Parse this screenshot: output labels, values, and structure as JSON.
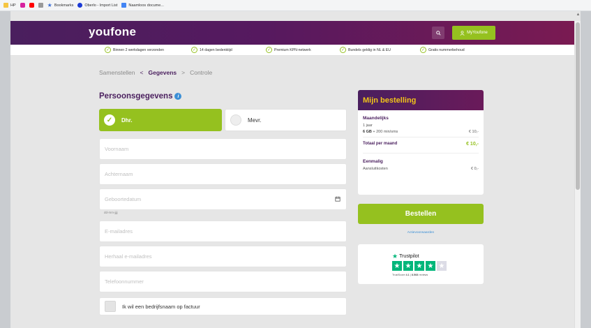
{
  "bookmarks": [
    {
      "label": "HP",
      "icon": "folder-icon",
      "color": "#f5c542"
    },
    {
      "label": "",
      "icon": "instagram-icon",
      "color": "#d6249f"
    },
    {
      "label": "",
      "icon": "youtube-icon",
      "color": "#ff0000"
    },
    {
      "label": "",
      "icon": "grid-icon",
      "color": "#888888"
    },
    {
      "label": "Bookmarks",
      "icon": "star-icon",
      "color": "#3b6fd6"
    },
    {
      "label": "Oberlo - Import List",
      "icon": "oberlo-icon",
      "color": "#1c3bd6"
    },
    {
      "label": "Naamloos docume...",
      "icon": "docs-icon",
      "color": "#4285f4"
    }
  ],
  "header": {
    "logo": "youfone",
    "search_icon": "search-icon",
    "account_label": "MyYoufone"
  },
  "usp": [
    "Binnen 2 werkdagen verzonden",
    "14 dagen bedenktijd",
    "Premium KPN-netwerk",
    "Bundels geldig in NL & EU",
    "Gratis nummerbehoud"
  ],
  "breadcrumb": {
    "step1": "Samenstellen",
    "step2": "Gegevens",
    "step3": "Controle",
    "sep1": "<",
    "sep2": ">"
  },
  "form": {
    "title": "Persoonsgegevens",
    "gender_male": "Dhr.",
    "gender_female": "Mevr.",
    "voornaam": "Voornaam",
    "achternaam": "Achternaam",
    "geboortedatum": "Geboortedatum",
    "date_hint": "dd-mm-jjjj",
    "email": "E-mailadres",
    "email_repeat": "Herhaal e-mailadres",
    "phone": "Telefoonnummer",
    "company_checkbox": "Ik wil een bedrijfsnaam op factuur"
  },
  "order": {
    "title": "Mijn bestelling",
    "monthly_label": "Maandelijks",
    "duration": "1 jaar",
    "bundle_gb": "6 GB",
    "bundle_rest": " + 200 min/sms",
    "bundle_price": "€ 10,-",
    "total_label": "Totaal per maand",
    "total_price": "€ 10,-",
    "oneoff_label": "Eenmalig",
    "connection_label": "Aansluitkosten",
    "connection_price": "€ 0,-"
  },
  "cta": {
    "order_button": "Bestellen",
    "action_terms": "Actievoorwaarden"
  },
  "trustpilot": {
    "brand": "Trustpilot",
    "score_prefix": "TrustScore ",
    "score": "4.1",
    "sep": " | ",
    "reviews": "8.568",
    "reviews_suffix": " reviews",
    "rating": 4.1,
    "brand_color": "#00b67a"
  },
  "colors": {
    "purple": "#4a1f5e",
    "green": "#95c11f",
    "yellow": "#f0c419",
    "info_blue": "#3b8fd6"
  }
}
